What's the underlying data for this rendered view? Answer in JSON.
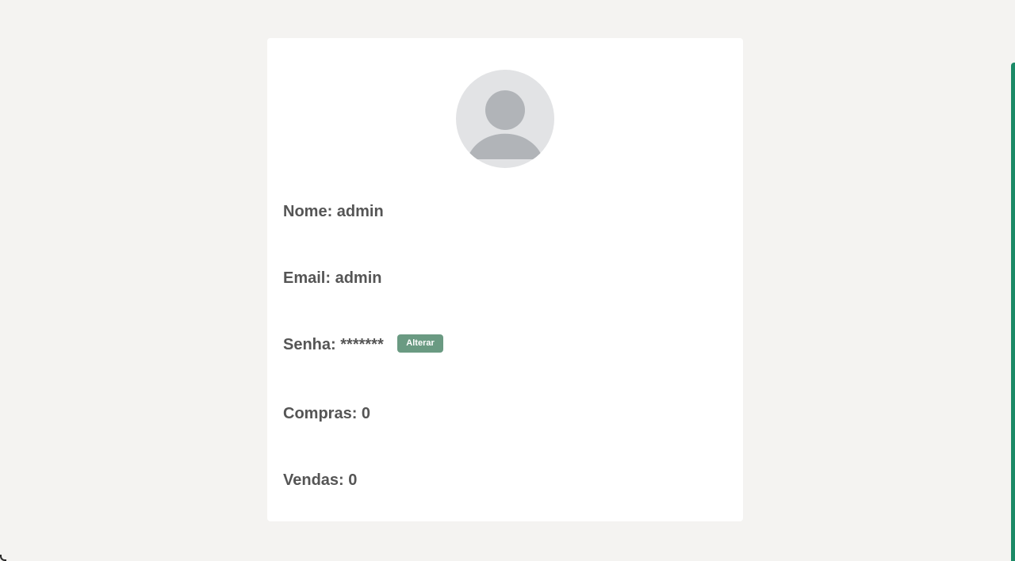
{
  "profile": {
    "fields": {
      "name": {
        "label": "Nome:",
        "value": "admin"
      },
      "email": {
        "label": "Email:",
        "value": "admin"
      },
      "password": {
        "label": "Senha:",
        "value": "*******",
        "change_label": "Alterar"
      },
      "purchases": {
        "label": "Compras:",
        "value": "0"
      },
      "sales": {
        "label": "Vendas:",
        "value": "0"
      }
    },
    "avatar_icon": "default-user-icon"
  },
  "colors": {
    "background": "#f4f3f1",
    "card": "#ffffff",
    "text": "#555555",
    "button": "#6a9a82",
    "accent": "#1b8a66",
    "avatar_bg": "#e2e3e5",
    "avatar_fg": "#b1b4b8"
  }
}
